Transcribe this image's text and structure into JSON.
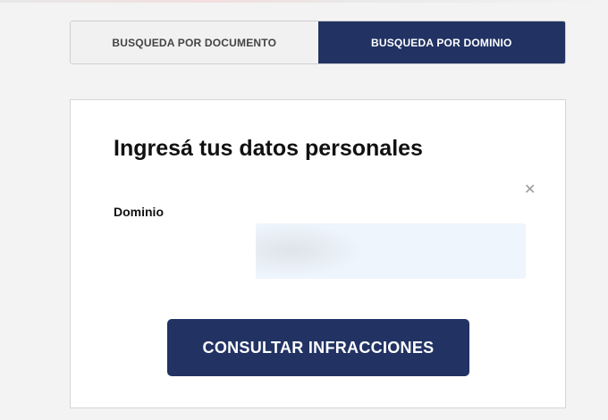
{
  "tabs": [
    {
      "label": "BUSQUEDA POR DOCUMENTO",
      "active": false
    },
    {
      "label": "BUSQUEDA POR DOMINIO",
      "active": true
    }
  ],
  "form": {
    "title": "Ingresá tus datos personales",
    "close_icon": "close-icon",
    "field_label": "Dominio",
    "field_value": "",
    "submit_label": "CONSULTAR INFRACCIONES"
  },
  "colors": {
    "primary": "#213263",
    "inactive_tab_bg": "#f1f1f1",
    "input_bg": "#eef5fc"
  }
}
